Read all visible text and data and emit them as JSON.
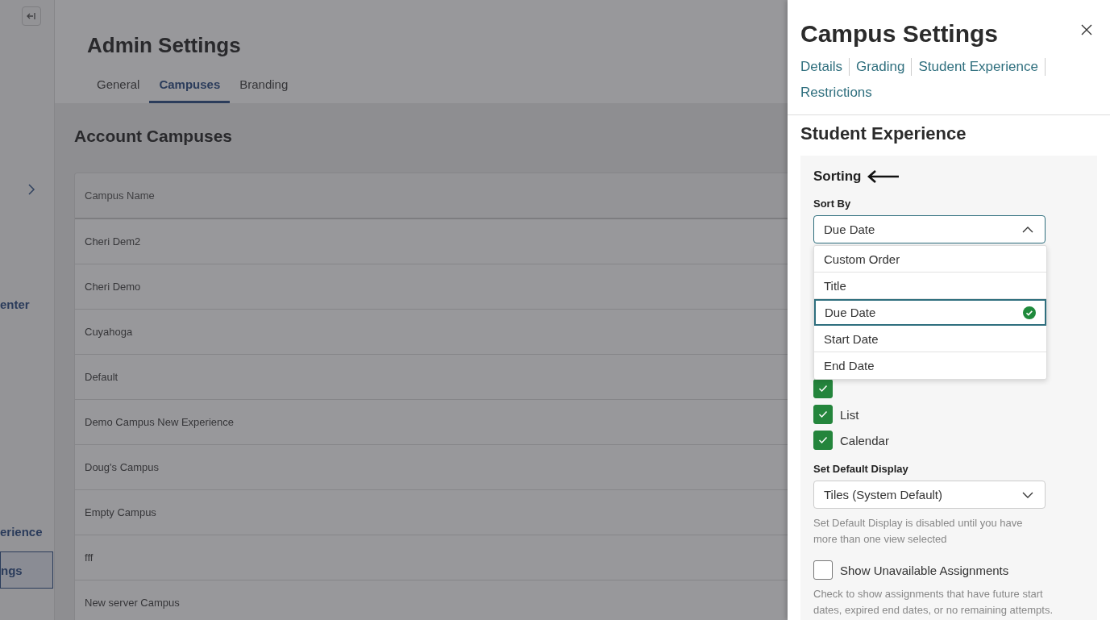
{
  "sidebar": {
    "items": [
      {
        "label": "enter",
        "selected": false
      },
      {
        "label": "erience",
        "selected": false
      },
      {
        "label": "ngs",
        "selected": true
      }
    ]
  },
  "page": {
    "title": "Admin Settings",
    "tabs": [
      {
        "label": "General",
        "selected": false
      },
      {
        "label": "Campuses",
        "selected": true
      },
      {
        "label": "Branding",
        "selected": false
      }
    ]
  },
  "campuses": {
    "title": "Account Campuses",
    "columns": [
      "Campus Name"
    ],
    "rows": [
      "Cheri Dem2",
      "Cheri Demo",
      "Cuyahoga",
      "Default",
      "Demo Campus New Experience",
      "Doug's Campus",
      "Empty Campus",
      "fff",
      "New server Campus"
    ]
  },
  "panel": {
    "title": "Campus Settings",
    "links": [
      {
        "label": "Details",
        "selected": false
      },
      {
        "label": "Grading",
        "selected": false
      },
      {
        "label": "Student Experience",
        "selected": false
      },
      {
        "label": "Restrictions",
        "selected": false
      }
    ],
    "section": "Student Experience",
    "group": "Sorting",
    "sort_by": {
      "label": "Sort By",
      "value": "Due Date",
      "expanded": true,
      "options": [
        {
          "label": "Custom Order",
          "selected": false
        },
        {
          "label": "Title",
          "selected": false
        },
        {
          "label": "Due Date",
          "selected": true
        },
        {
          "label": "Start Date",
          "selected": false
        },
        {
          "label": "End Date",
          "selected": false
        }
      ]
    },
    "views": [
      {
        "checked": true
      },
      {
        "label": "List",
        "checked": true
      },
      {
        "label": "Calendar",
        "checked": true
      }
    ],
    "default_display": {
      "label": "Set Default Display",
      "value": "Tiles (System Default)",
      "expanded": false,
      "help": "Set Default Display is disabled until you have more than one view selected"
    },
    "unavailable": {
      "label": "Show Unavailable Assignments",
      "checked": false,
      "help": "Check to show assignments that have future start dates, expired end dates, or no remaining attempts."
    }
  }
}
